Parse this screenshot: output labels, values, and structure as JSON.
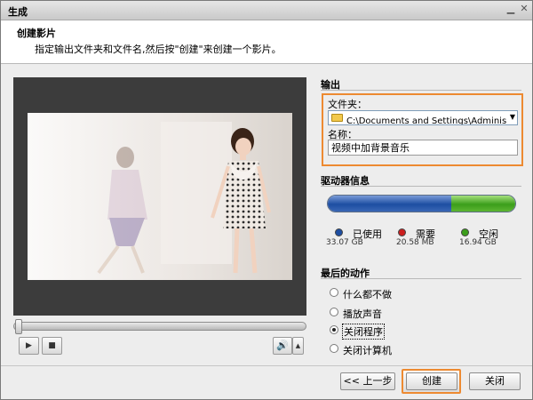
{
  "window": {
    "title": "生成"
  },
  "header": {
    "title": "创建影片",
    "description": "指定输出文件夹和文件名,然后按\"创建\"来创建一个影片。"
  },
  "output": {
    "section_title": "输出",
    "folder_label": "文件夹：",
    "folder_value": "C:\\Documents and Settings\\Administrator\\桌面",
    "name_label": "名称：",
    "name_value": "视频中加背景音乐"
  },
  "drive": {
    "section_title": "驱动器信息",
    "used_label": "已使用",
    "used_size": "33.07 GB",
    "needed_label": "需要",
    "needed_size": "20.58 MB",
    "free_label": "空闲",
    "free_size": "16.94 GB",
    "used_fraction": 0.661,
    "colors": {
      "used": "#1d4ea2",
      "needed": "#cc1f1f",
      "free": "#3b9e1b"
    }
  },
  "final_action": {
    "section_title": "最后的动作",
    "options": [
      "什么都不做",
      "播放声音",
      "关闭程序",
      "关闭计算机"
    ],
    "selected_index": 2
  },
  "playback": {
    "seek_position": 0.0
  },
  "buttons": {
    "prev": "<< 上一步",
    "create": "创建",
    "close": "关闭"
  },
  "colors": {
    "highlight": "#ed8a31"
  }
}
